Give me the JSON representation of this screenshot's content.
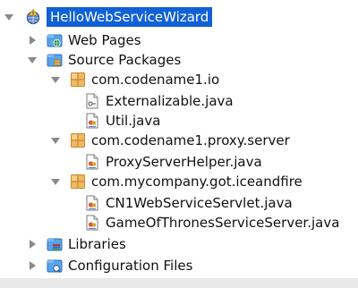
{
  "project": {
    "name": "HelloWebServiceWizard",
    "expanded": true,
    "selected": true,
    "icon": "project-icon"
  },
  "nodes": {
    "web_pages": {
      "label": "Web Pages",
      "icon": "web-pages-folder-icon",
      "expanded": false
    },
    "source_packages": {
      "label": "Source Packages",
      "icon": "source-packages-folder-icon",
      "expanded": true
    },
    "pkg_io": {
      "label": "com.codename1.io",
      "icon": "package-icon",
      "expanded": true
    },
    "file_externalizable": {
      "label": "Externalizable.java",
      "icon": "interface-file-icon"
    },
    "file_util": {
      "label": "Util.java",
      "icon": "java-class-file-icon"
    },
    "pkg_proxy": {
      "label": "com.codename1.proxy.server",
      "icon": "package-icon",
      "expanded": true
    },
    "file_proxy_helper": {
      "label": "ProxyServerHelper.java",
      "icon": "java-class-file-icon"
    },
    "pkg_iceandfire": {
      "label": "com.mycompany.got.iceandfire",
      "icon": "package-icon",
      "expanded": true
    },
    "file_cn1_servlet": {
      "label": "CN1WebServiceServlet.java",
      "icon": "java-class-file-icon"
    },
    "file_got_server": {
      "label": "GameOfThronesServiceServer.java",
      "icon": "java-class-file-icon"
    },
    "libraries": {
      "label": "Libraries",
      "icon": "libraries-folder-icon",
      "expanded": false
    },
    "config_files": {
      "label": "Configuration Files",
      "icon": "config-folder-icon",
      "expanded": false
    }
  },
  "colors": {
    "selection": "#1060d8",
    "folder_blue": "#5aa3e6",
    "package_orange": "#f0b866",
    "triangle_gray": "#8a8a8a"
  }
}
